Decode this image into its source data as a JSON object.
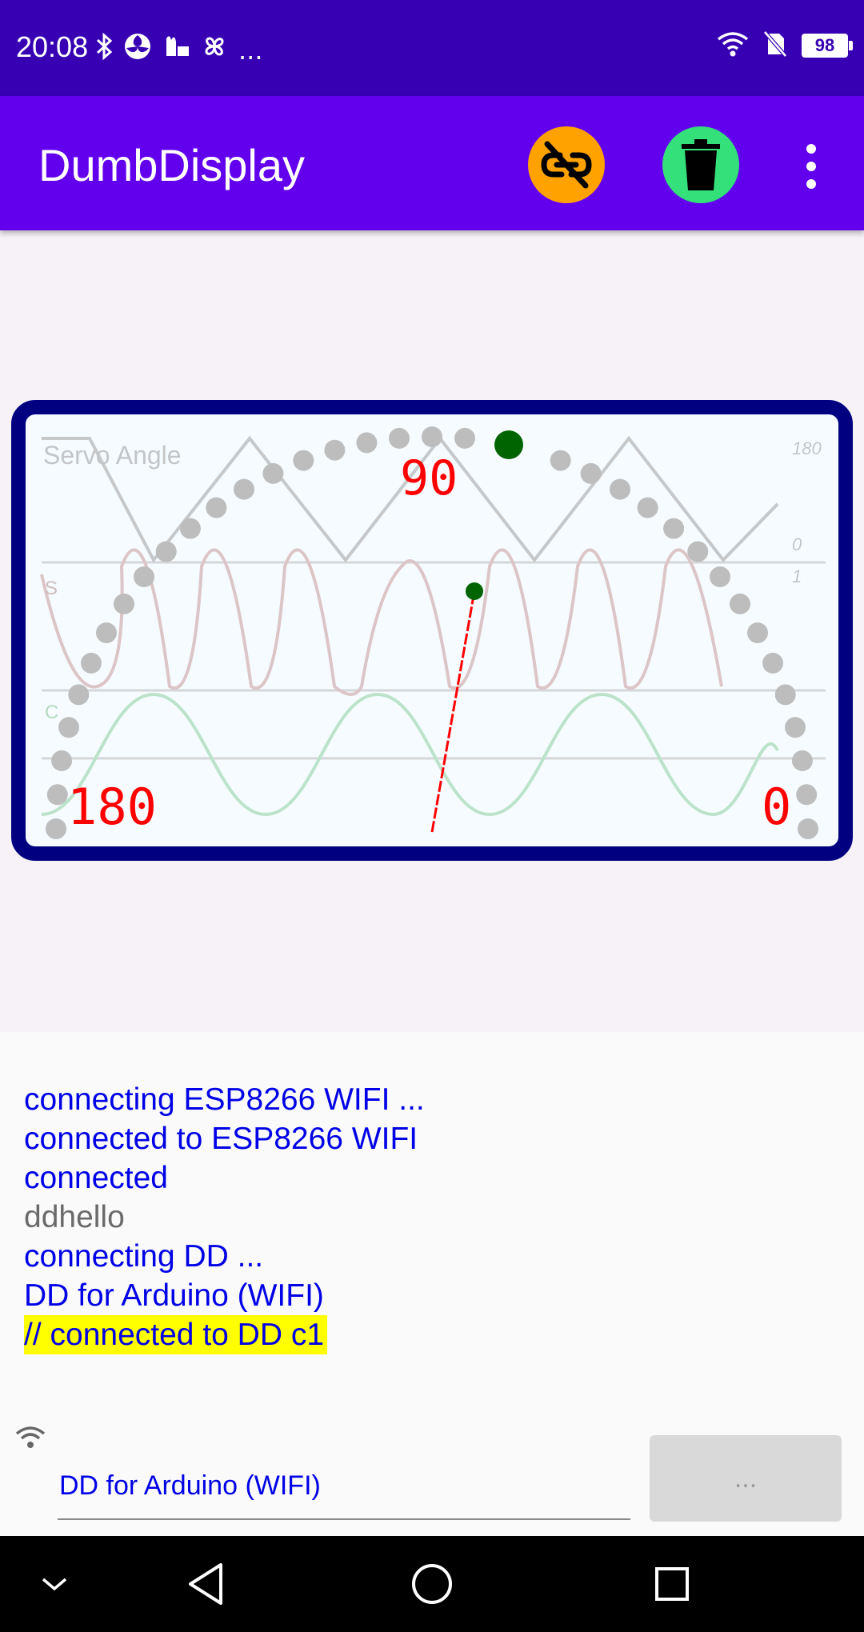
{
  "status_bar": {
    "time": "20:08",
    "more": "...",
    "battery": "98",
    "icons": [
      "bluetooth-icon",
      "fan-icon",
      "weather-icon",
      "pinwheel-icon",
      "wifi-icon",
      "no-sim-icon",
      "battery-icon"
    ]
  },
  "app_bar": {
    "title": "DumbDisplay",
    "actions": [
      "link-off-icon",
      "trash-icon",
      "more-vert-icon"
    ],
    "link_button_color": "#ffa200",
    "trash_button_color": "#33e07a"
  },
  "display": {
    "plot_label": "Servo Angle",
    "plot_legend_top": "180",
    "plot_legend_mid": "0",
    "plot_legend_bot": "1",
    "series_s": "S",
    "series_c": "C",
    "gauge_label_top": "90",
    "gauge_label_left": "180",
    "gauge_label_right": "0",
    "border_color": "#000080",
    "needle_color": "#ff0000",
    "knob_color": "#006400"
  },
  "log": {
    "lines": [
      {
        "text": "connecting ESP8266 WIFI ...",
        "style": "blue"
      },
      {
        "text": "connected to ESP8266 WIFI",
        "style": "blue"
      },
      {
        "text": "connected",
        "style": "blue"
      },
      {
        "text": "ddhello",
        "style": "gray"
      },
      {
        "text": "connecting DD ...",
        "style": "blue"
      },
      {
        "text": "DD for Arduino (WIFI)",
        "style": "blue"
      },
      {
        "text": "// connected to DD c1",
        "style": "highlight"
      }
    ]
  },
  "input": {
    "value": "DD for Arduino (WIFI)",
    "send_label": "..."
  },
  "nav_bar": {
    "items": [
      "collapse-icon",
      "back-icon",
      "home-icon",
      "recents-icon"
    ]
  }
}
